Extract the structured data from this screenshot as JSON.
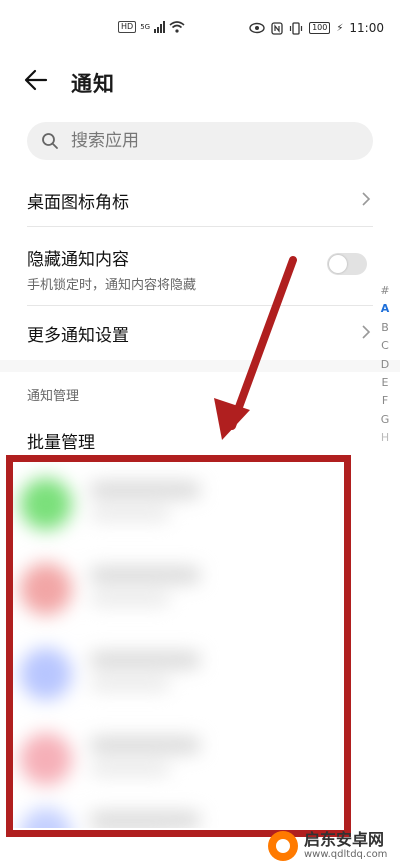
{
  "status_bar": {
    "left_icons": [
      "hd-icon",
      "5g-signal-icon",
      "wifi-icon"
    ],
    "hd_label": "HD",
    "net_label": "5G",
    "right_icons": [
      "eye-icon",
      "nfc-icon",
      "vibrate-icon"
    ],
    "battery": "100",
    "time": "11:00"
  },
  "header": {
    "title": "通知"
  },
  "search": {
    "placeholder": "搜索应用"
  },
  "settings": {
    "desktop_badge": "桌面图标角标",
    "hide_content": "隐藏通知内容",
    "hide_content_desc": "手机锁定时，通知内容将隐藏",
    "more_settings": "更多通知设置"
  },
  "section": {
    "title": "通知管理",
    "batch_manage": "批量管理"
  },
  "alpha_index": {
    "letters": [
      "#",
      "A",
      "B",
      "C",
      "D",
      "E",
      "F",
      "G",
      "H"
    ],
    "active": "A"
  },
  "colors": {
    "accent": "#1e6fd9",
    "annotation_red": "#b01f1f"
  },
  "watermark": {
    "name": "启东安卓网",
    "url": "www.qdltdq.com"
  }
}
